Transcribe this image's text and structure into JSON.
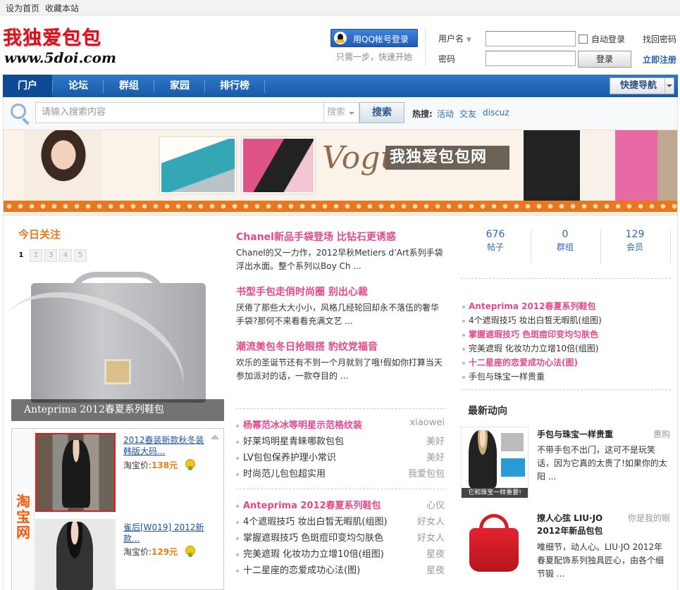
{
  "topbar": {
    "set_home": "设为首页",
    "bookmark": "收藏本站"
  },
  "logo": {
    "cn": "我独爱包包",
    "url": "www.5doi.com"
  },
  "login": {
    "qq_button": "用QQ帐号登录",
    "qq_sub": "只需一步，快速开始",
    "username_label": "用户名",
    "password_label": "密码",
    "auto_login": "自动登录",
    "login_button": "登录",
    "find_password": "找回密码",
    "register": "立即注册"
  },
  "nav": {
    "items": [
      "门户",
      "论坛",
      "群组",
      "家园",
      "排行榜"
    ],
    "active": "门户",
    "quick_nav": "快捷导航"
  },
  "search": {
    "placeholder": "请输入搜索内容",
    "type": "搜索",
    "button": "搜索",
    "hot_label": "热搜:",
    "hot": [
      "活动",
      "交友",
      "discuz"
    ]
  },
  "banner": {
    "vogue": "Vogue",
    "title": "我独爱包包网"
  },
  "today": {
    "title": "今日关注",
    "pages": [
      "1",
      "2",
      "3",
      "4",
      "5"
    ],
    "caption": "Anteprima 2012春夏系列鞋包"
  },
  "taobao": {
    "logo": "淘宝网",
    "items": [
      {
        "title": "2012春装新款秋冬装韩版大码...",
        "price_label": "淘宝价:",
        "price": "138元"
      },
      {
        "title": "雀后[W019] 2012新款...",
        "price_label": "淘宝价:",
        "price": "129元"
      }
    ]
  },
  "headlines": [
    {
      "title": "Chanel新品手袋登场 比钻石更诱惑",
      "desc": "Chanel的又一力作，2012早秋Metiers d’Art系列手袋浮出水面。整个系列以Boy Ch ..."
    },
    {
      "title": "书型手包走俏时尚圈 别出心裁",
      "desc": "厌倦了那些大大小小，风格几经轮回却永不落伍的奢华手袋?那何不来看看充满文艺 ..."
    },
    {
      "title": "潮流美包冬日抢眼搭 豹纹党福音",
      "desc": "欢乐的圣诞节还有不到一个月就到了哦!假如你打算当天参加派对的话，一款夺目的 ..."
    }
  ],
  "list1": [
    {
      "title": "杨幂范冰冰等明星示范格纹装",
      "author": "xiaowei",
      "hl": true
    },
    {
      "title": "好莱坞明星青睐哪款包包",
      "author": "美好",
      "hl": false
    },
    {
      "title": "LV包包保养护理小常识",
      "author": "美好",
      "hl": false
    },
    {
      "title": "时尚范儿包包超实用",
      "author": "我爱包包",
      "hl": false
    }
  ],
  "list2": [
    {
      "title": "Anteprima 2012春夏系列鞋包",
      "author": "心仪",
      "hl": true
    },
    {
      "title": "4个遮瑕技巧 妆出白皙无暇肌(组图)",
      "author": "好女人",
      "hl": false
    },
    {
      "title": "掌握遮瑕技巧 色斑痘印变均匀肤色",
      "author": "好女人",
      "hl": false
    },
    {
      "title": "完美遮瑕 化妆功力立增10倍(组图)",
      "author": "星夜",
      "hl": false
    },
    {
      "title": "十二星座的恋爱成功心法(图)",
      "author": "星夜",
      "hl": false
    }
  ],
  "stats": [
    {
      "num": "676",
      "label": "帖子"
    },
    {
      "num": "0",
      "label": "群组"
    },
    {
      "num": "129",
      "label": "会员"
    }
  ],
  "right_list": [
    {
      "title": "Anteprima 2012春夏系列鞋包",
      "hl": true
    },
    {
      "title": "4个遮瑕技巧 妆出白皙无暇肌(组图)",
      "hl": false
    },
    {
      "title": "掌握遮瑕技巧 色斑痘印变均匀肤色",
      "hl": true
    },
    {
      "title": "完美遮瑕 化妆功力立增10倍(组图)",
      "hl": false
    },
    {
      "title": "十二星座的恋爱成功心法(图)",
      "hl": true
    },
    {
      "title": "手包与珠宝一样贵重",
      "hl": false
    }
  ],
  "latest": {
    "title": "最新动向",
    "items": [
      {
        "title": "手包与珠宝一样贵重",
        "author": "惠购",
        "desc": "不带手包不出门，这可不是玩笑话，因为它真的太贵了!如果你的太阳 ...",
        "img_caption": "它和珠宝一样重要!"
      },
      {
        "title": "撩人心弦 LIU·JO 2012年新品包包",
        "author": "你是我的眼",
        "desc": "唯细节，动人心。LIU·JO 2012年春夏配饰系列独具匠心，由各个细节锻 ..."
      }
    ]
  }
}
